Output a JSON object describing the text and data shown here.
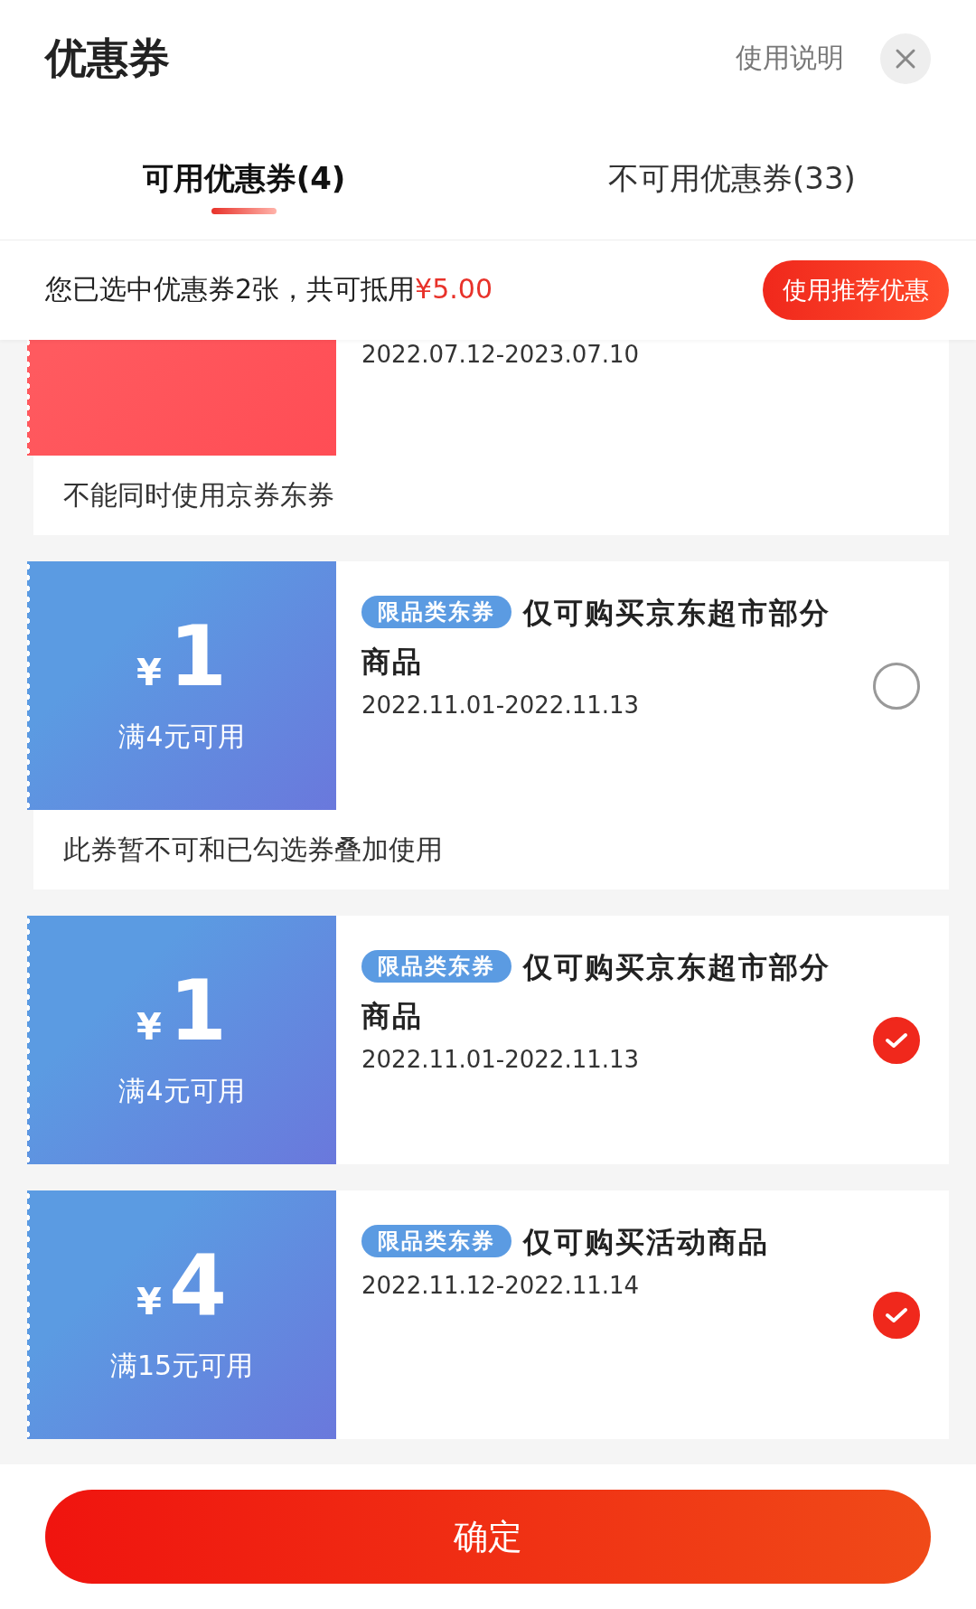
{
  "header": {
    "title": "优惠券",
    "help_link": "使用说明"
  },
  "tabs": [
    {
      "label": "可用优惠券(4)",
      "selected": true
    },
    {
      "label": "不可用优惠券(33)",
      "selected": false
    }
  ],
  "summary": {
    "text": "您已选中优惠券2张，共可抵用",
    "amount": "¥5.00",
    "button": "使用推荐优惠"
  },
  "coupons": [
    {
      "color": "#ff5a5f",
      "date": "2022.07.12-2023.07.10",
      "note": "不能同时使用京券东券"
    },
    {
      "color": "#5b9be2",
      "currency": "¥",
      "amount": "1",
      "condition": "满4元可用",
      "tag": "限品类东券",
      "title": "仅可购买京东超市部分商品",
      "date": "2022.11.01-2022.11.13",
      "selected": false,
      "note": "此券暂不可和已勾选券叠加使用"
    },
    {
      "color": "#5b9be2",
      "currency": "¥",
      "amount": "1",
      "condition": "满4元可用",
      "tag": "限品类东券",
      "title": "仅可购买京东超市部分商品",
      "date": "2022.11.01-2022.11.13",
      "selected": true
    },
    {
      "color": "#5b9be2",
      "currency": "¥",
      "amount": "4",
      "condition": "满15元可用",
      "tag": "限品类东券",
      "title": "仅可购买活动商品",
      "date": "2022.11.12-2022.11.14",
      "selected": true
    }
  ],
  "confirm_button": "确定"
}
